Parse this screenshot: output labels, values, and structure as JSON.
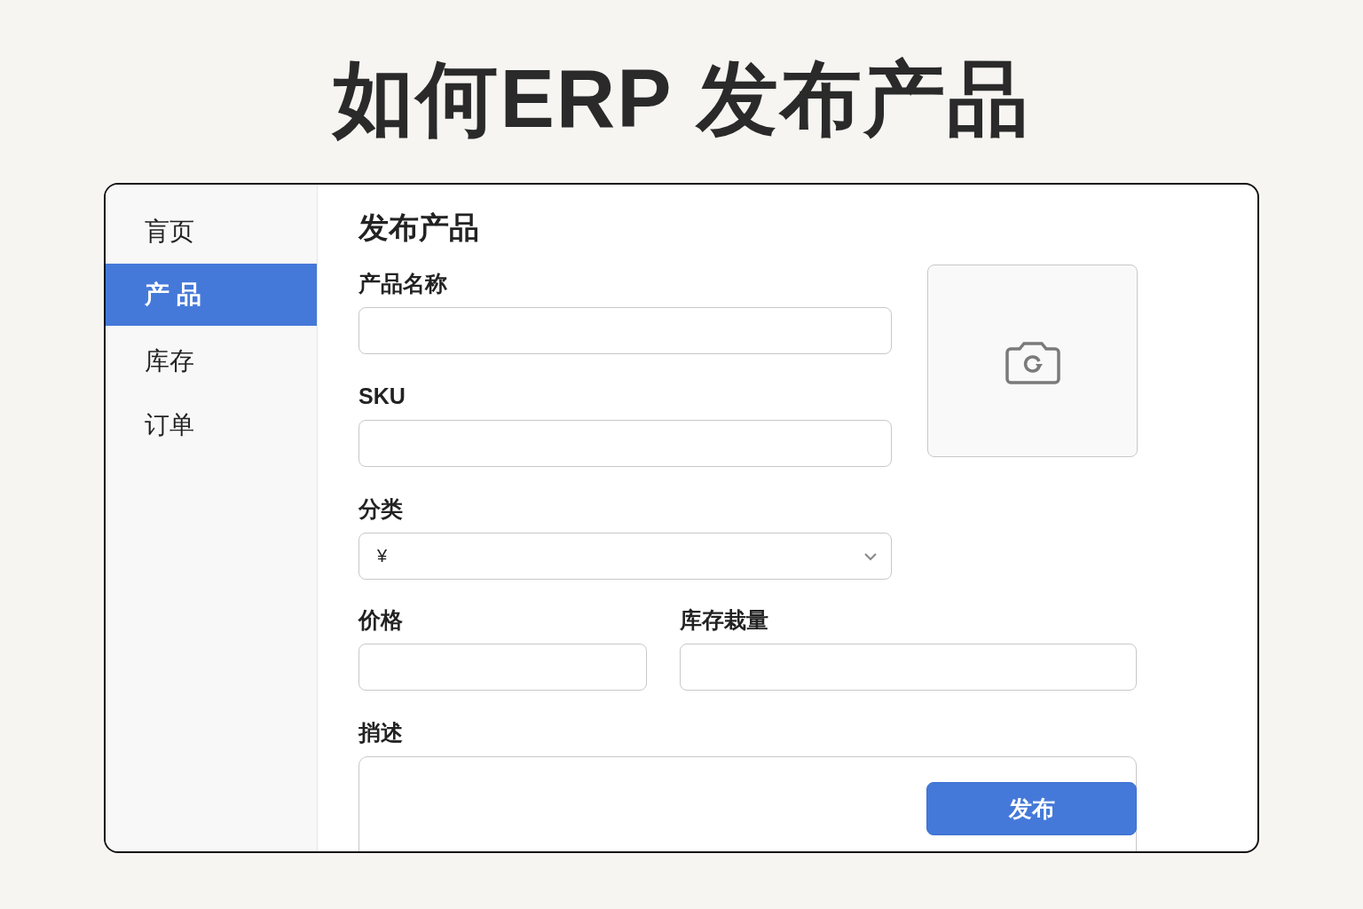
{
  "headline": "如何ERP 发布产品",
  "sidebar": {
    "items": [
      {
        "label": "肓页",
        "selected": false
      },
      {
        "label": "产 品",
        "selected": true
      },
      {
        "label": "库存",
        "selected": false
      },
      {
        "label": "订单",
        "selected": false
      }
    ]
  },
  "page_title": "发布产品",
  "fields": [
    {
      "kind": "text",
      "label": "产品名称"
    },
    {
      "kind": "text",
      "label": "SKU"
    },
    {
      "kind": "select",
      "label": "分类",
      "value": "¥"
    }
  ],
  "price": {
    "label": "价格"
  },
  "stock": {
    "label": "库存栽量"
  },
  "description": {
    "label": "捎述"
  },
  "image_upload": {
    "kind": "camera"
  },
  "publish_button": {
    "label": "发布"
  }
}
